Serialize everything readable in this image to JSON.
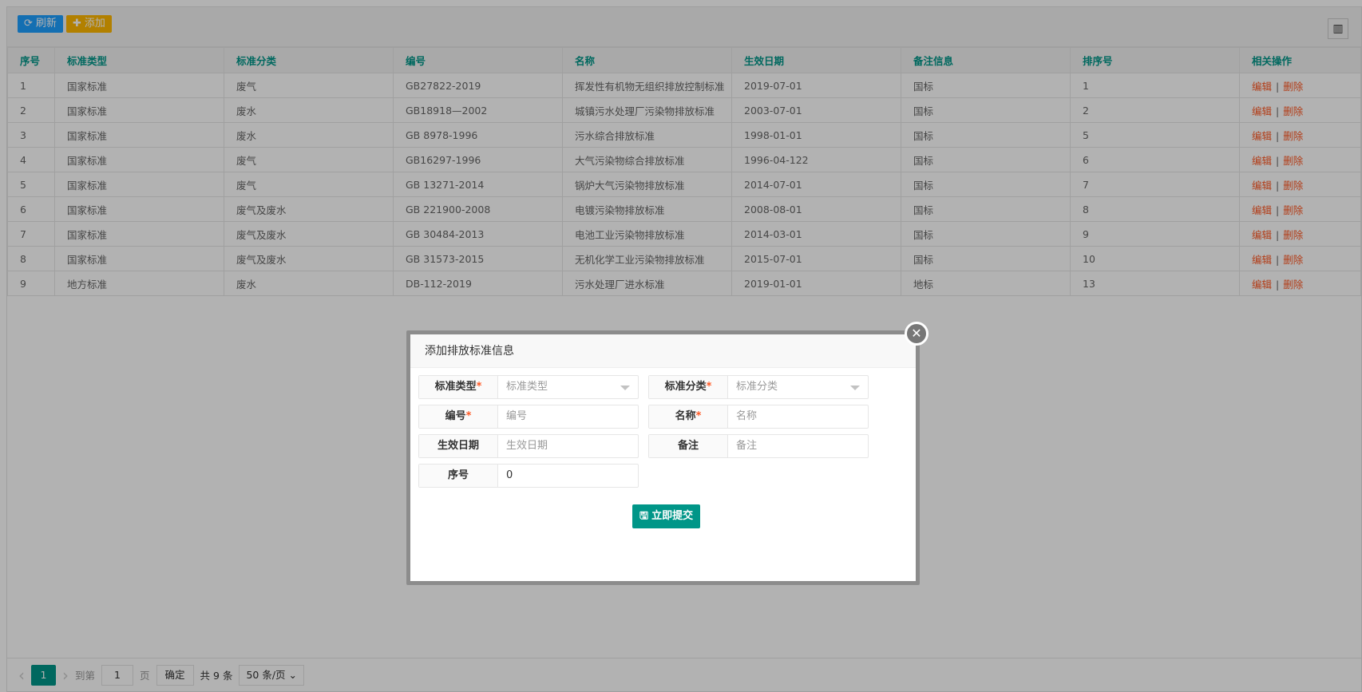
{
  "toolbar": {
    "refresh": "刷新",
    "add": "添加",
    "refresh_icon": "refresh-icon",
    "add_icon": "plus-icon",
    "columns_icon": "columns-icon"
  },
  "table": {
    "headers": [
      "序号",
      "标准类型",
      "标准分类",
      "编号",
      "名称",
      "生效日期",
      "备注信息",
      "排序号",
      "相关操作"
    ],
    "rows": [
      [
        "1",
        "国家标准",
        "废气",
        "GB27822-2019",
        "挥发性有机物无组织排放控制标准",
        "2019-07-01",
        "国标",
        "1"
      ],
      [
        "2",
        "国家标准",
        "废水",
        "GB18918—2002",
        "城镇污水处理厂污染物排放标准",
        "2003-07-01",
        "国标",
        "2"
      ],
      [
        "3",
        "国家标准",
        "废水",
        "GB 8978-1996",
        "污水综合排放标准",
        "1998-01-01",
        "国标",
        "5"
      ],
      [
        "4",
        "国家标准",
        "废气",
        "GB16297-1996",
        "大气污染物综合排放标准",
        "1996-04-122",
        "国标",
        "6"
      ],
      [
        "5",
        "国家标准",
        "废气",
        "GB 13271-2014",
        "锅炉大气污染物排放标准",
        "2014-07-01",
        "国标",
        "7"
      ],
      [
        "6",
        "国家标准",
        "废气及废水",
        "GB 221900-2008",
        "电镀污染物排放标准",
        "2008-08-01",
        "国标",
        "8"
      ],
      [
        "7",
        "国家标准",
        "废气及废水",
        "GB 30484-2013",
        "电池工业污染物排放标准",
        "2014-03-01",
        "国标",
        "9"
      ],
      [
        "8",
        "国家标准",
        "废气及废水",
        "GB 31573-2015",
        "无机化学工业污染物排放标准",
        "2015-07-01",
        "国标",
        "10"
      ],
      [
        "9",
        "地方标准",
        "废水",
        "DB-112-2019",
        "污水处理厂进水标准",
        "2019-01-01",
        "地标",
        "13"
      ]
    ],
    "edit": "编辑",
    "sep": "|",
    "delete": "删除"
  },
  "pager": {
    "prev": "‹",
    "current": "1",
    "next": "›",
    "goto": "到第",
    "page_input": "1",
    "page_unit": "页",
    "confirm": "确定",
    "total": "共 9 条",
    "page_size": "50 条/页"
  },
  "dialog": {
    "title": "添加排放标准信息",
    "close": "✕",
    "fields": [
      {
        "label": "标准类型",
        "required": "*",
        "placeholder": "标准类型",
        "value": ""
      },
      {
        "label": "标准分类",
        "required": "*",
        "placeholder": "标准分类",
        "value": ""
      },
      {
        "label": "编号",
        "required": "*",
        "placeholder": "编号",
        "value": ""
      },
      {
        "label": "名称",
        "required": "*",
        "placeholder": "名称",
        "value": ""
      },
      {
        "label": "生效日期",
        "required": "",
        "placeholder": "生效日期",
        "value": ""
      },
      {
        "label": "备注",
        "required": "",
        "placeholder": "备注",
        "value": ""
      },
      {
        "label": "序号",
        "required": "",
        "placeholder": "",
        "value": "0"
      }
    ],
    "submit": "立即提交"
  },
  "colors": {
    "primary": "#009688",
    "refresh": "#1E9FFF",
    "add": "#FFB800",
    "danger": "#FF5722"
  }
}
